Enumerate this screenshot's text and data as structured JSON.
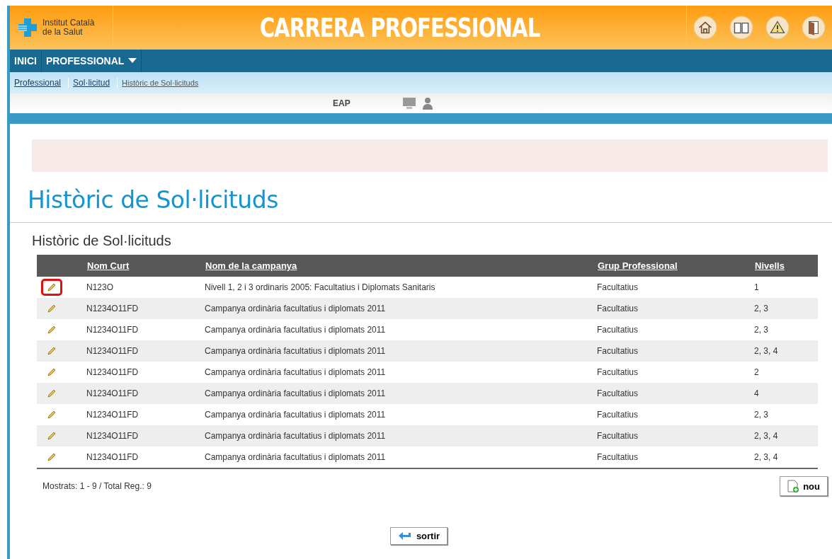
{
  "header": {
    "logo_text": [
      "Institut Català",
      "de la Salut"
    ],
    "title": "CARRERA PROFESSIONAL"
  },
  "nav": [
    {
      "label": "INICI",
      "dropdown": false
    },
    {
      "label": "PROFESSIONAL",
      "dropdown": true
    }
  ],
  "breadcrumb": [
    {
      "label": "Professional",
      "current": false
    },
    {
      "label": "Sol·licitud",
      "current": false
    },
    {
      "label": "Històric de Sol·licituds",
      "current": true
    }
  ],
  "info_bar": {
    "unit": "EAP"
  },
  "page_title": "Històric de Sol·licituds",
  "section_title": "Històric de Sol·licituds",
  "table": {
    "columns": [
      "Nom Curt",
      "Nom de la campanya",
      "Grup Professional",
      "Nivells"
    ],
    "rows": [
      {
        "highlighted": true,
        "cells": [
          "N123O",
          "Nivell 1, 2 i 3 ordinaris 2005: Facultatius i Diplomats Sanitaris",
          "Facultatius",
          "1"
        ]
      },
      {
        "highlighted": false,
        "cells": [
          "N1234O11FD",
          "Campanya ordinària facultatius i diplomats 2011",
          "Facultatius",
          "2, 3"
        ]
      },
      {
        "highlighted": false,
        "cells": [
          "N1234O11FD",
          "Campanya ordinària facultatius i diplomats 2011",
          "Facultatius",
          "2, 3"
        ]
      },
      {
        "highlighted": false,
        "cells": [
          "N1234O11FD",
          "Campanya ordinària facultatius i diplomats 2011",
          "Facultatius",
          "2, 3, 4"
        ]
      },
      {
        "highlighted": false,
        "cells": [
          "N1234O11FD",
          "Campanya ordinària facultatius i diplomats 2011",
          "Facultatius",
          "2"
        ]
      },
      {
        "highlighted": false,
        "cells": [
          "N1234O11FD",
          "Campanya ordinària facultatius i diplomats 2011",
          "Facultatius",
          "4"
        ]
      },
      {
        "highlighted": false,
        "cells": [
          "N1234O11FD",
          "Campanya ordinària facultatius i diplomats 2011",
          "Facultatius",
          "2, 3"
        ]
      },
      {
        "highlighted": false,
        "cells": [
          "N1234O11FD",
          "Campanya ordinària facultatius i diplomats 2011",
          "Facultatius",
          "2, 3, 4"
        ]
      },
      {
        "highlighted": false,
        "cells": [
          "N1234O11FD",
          "Campanya ordinària facultatius i diplomats 2011",
          "Facultatius",
          "2, 3, 4"
        ]
      }
    ]
  },
  "footer": {
    "summary": "Mostrats: 1 - 9 / Total Reg.: 9",
    "new_button": "nou"
  },
  "exit_button": "sortir"
}
